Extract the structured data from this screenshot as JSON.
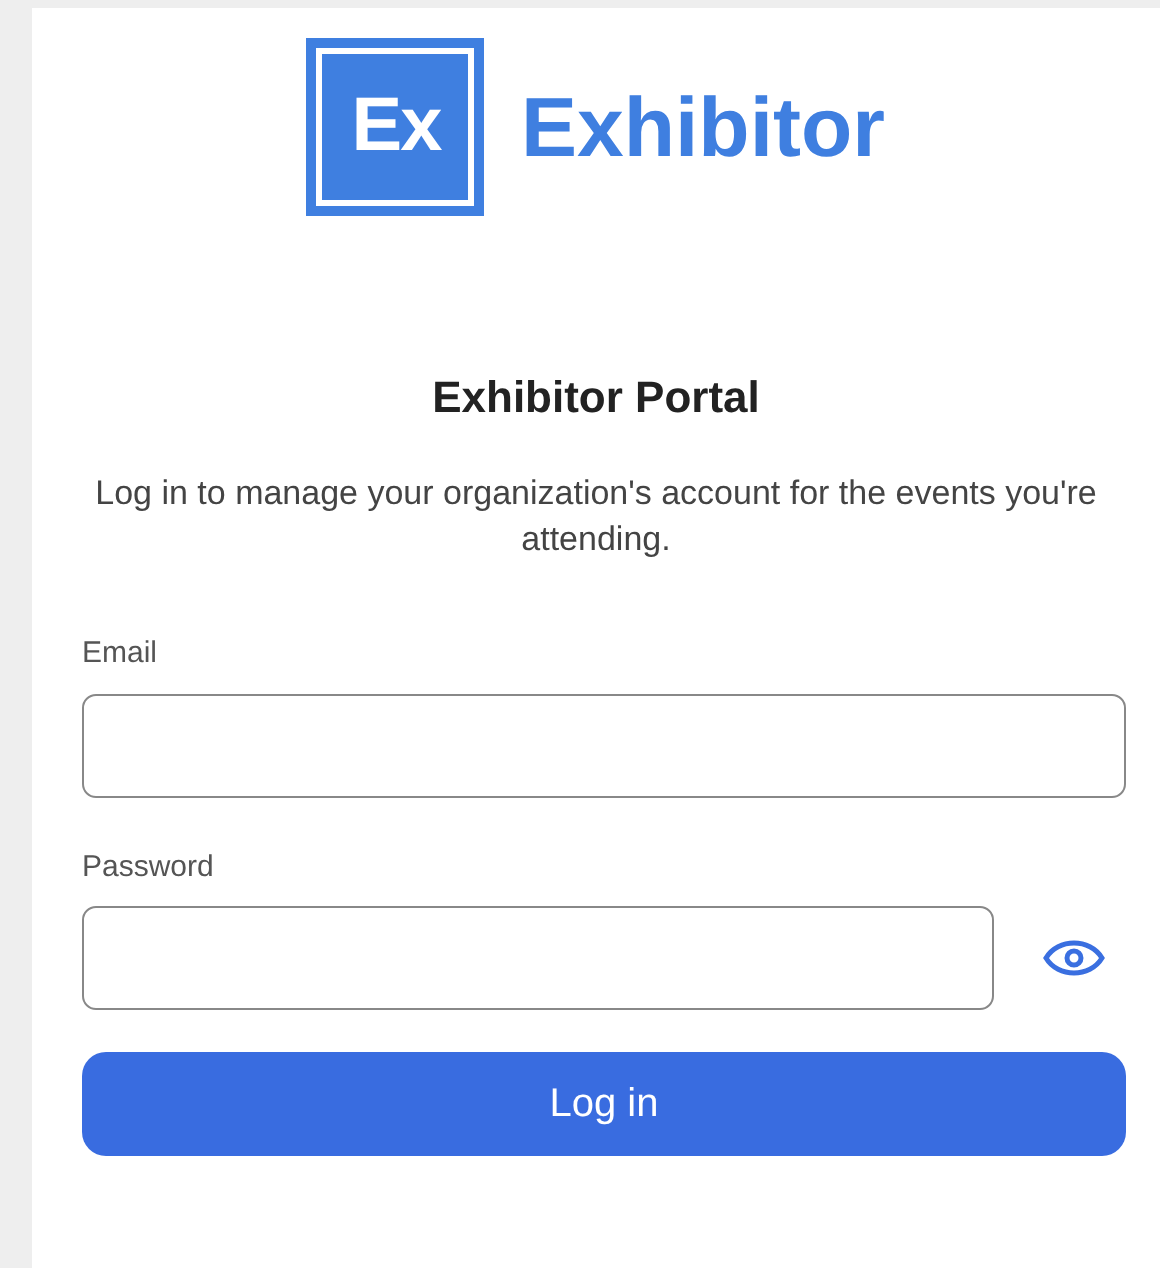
{
  "logo": {
    "mark": "Ex",
    "name": "Exhibitor"
  },
  "title": "Exhibitor Portal",
  "subtitle": "Log in to manage your organization's account for the events you're attending.",
  "fields": [
    {
      "label": "Email",
      "kind": "text"
    },
    {
      "label": "Password",
      "kind": "password"
    }
  ],
  "button": "Log in"
}
